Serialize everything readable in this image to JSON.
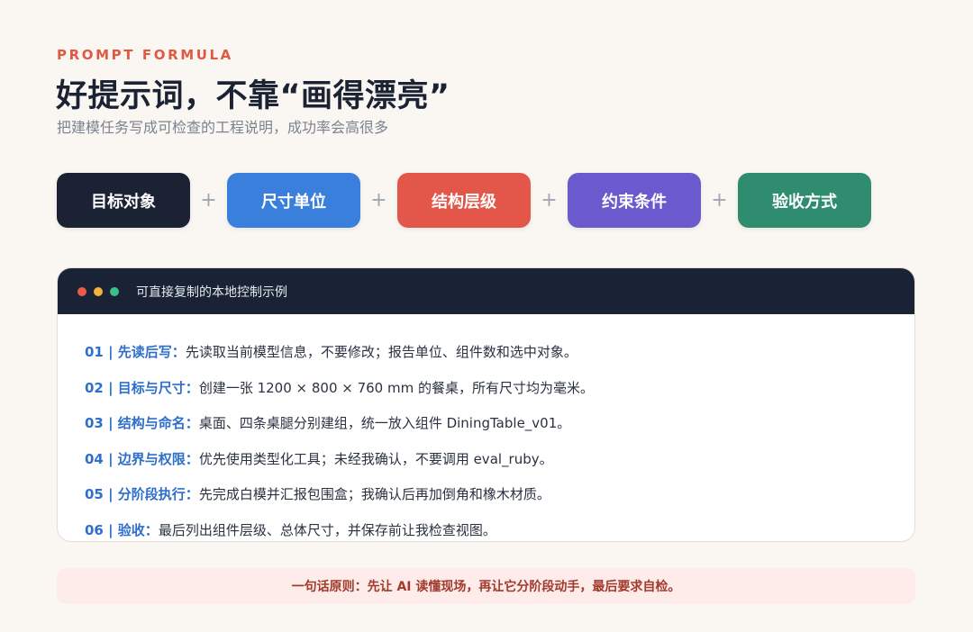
{
  "header": {
    "eyebrow": "PROMPT FORMULA",
    "title": "好提示词，不靠“画得漂亮”",
    "subtitle": "把建模任务写成可检查的工程说明，成功率会高很多"
  },
  "formula": {
    "items": [
      {
        "label": "目标对象",
        "color": "#1a2233"
      },
      {
        "label": "尺寸单位",
        "color": "#3a7fdb"
      },
      {
        "label": "结构层级",
        "color": "#e2574a"
      },
      {
        "label": "约束条件",
        "color": "#6a5acd"
      },
      {
        "label": "验收方式",
        "color": "#2f8c6f"
      }
    ],
    "plus": "+"
  },
  "example": {
    "window_dots": [
      "#e85d4a",
      "#f2b33d",
      "#3bbf8a"
    ],
    "title": "可直接复制的本地控制示例",
    "rows": [
      {
        "label": "01 | 先读后写：",
        "text": "先读取当前模型信息，不要修改；报告单位、组件数和选中对象。"
      },
      {
        "label": "02 | 目标与尺寸：",
        "text": "创建一张 1200 × 800 × 760 mm 的餐桌，所有尺寸均为毫米。"
      },
      {
        "label": "03 | 结构与命名：",
        "text": "桌面、四条桌腿分别建组，统一放入组件 DiningTable_v01。"
      },
      {
        "label": "04 | 边界与权限：",
        "text": "优先使用类型化工具；未经我确认，不要调用 eval_ruby。"
      },
      {
        "label": "05 | 分阶段执行：",
        "text": "先完成白模并汇报包围盒；我确认后再加倒角和橡木材质。"
      },
      {
        "label": "06 | 验收：",
        "text": "最后列出组件层级、总体尺寸，并保存前让我检查视图。"
      }
    ]
  },
  "principle": "一句话原则：先让 AI 读懂现场，再让它分阶段动手，最后要求自检。"
}
